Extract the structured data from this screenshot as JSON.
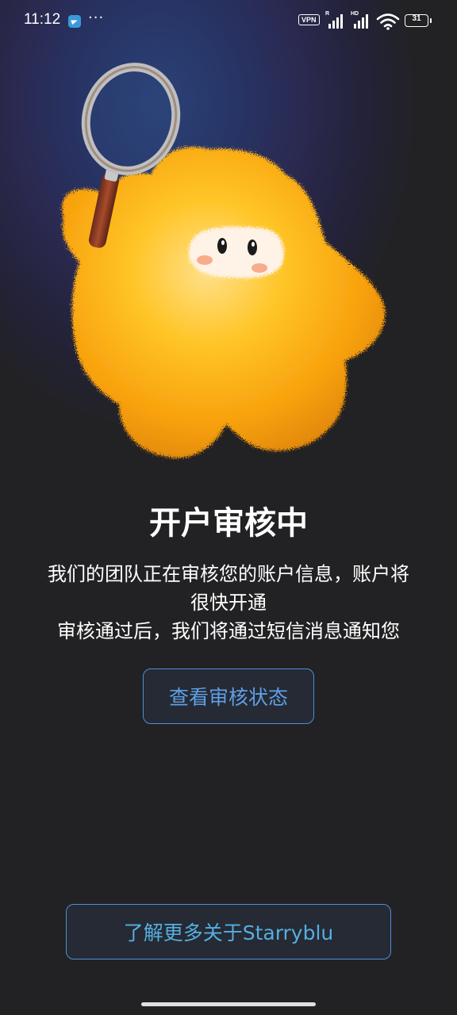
{
  "status_bar": {
    "time": "11:12",
    "notification_more": "···",
    "vpn_label": "VPN",
    "signal_1_tag": "R",
    "signal_2_tag": "HD",
    "battery_level": "31"
  },
  "main": {
    "title": "开户审核中",
    "description_lines": [
      "我们的团队正在审核您的账户信息，账户将",
      "很快开通",
      "审核通过后，我们将通过短信消息通知您"
    ],
    "check_status_button": "查看审核状态"
  },
  "footer": {
    "learn_more_button": "了解更多关于Starryblu"
  },
  "colors": {
    "background": "#222224",
    "accent": "#5f9fe6",
    "button_border": "#4c8fd6",
    "mascot": "#ffb21d"
  },
  "icons": [
    "telegram-icon",
    "more-icon",
    "vpn-icon",
    "signal-icon",
    "wifi-icon",
    "battery-icon",
    "magnifier-icon"
  ]
}
